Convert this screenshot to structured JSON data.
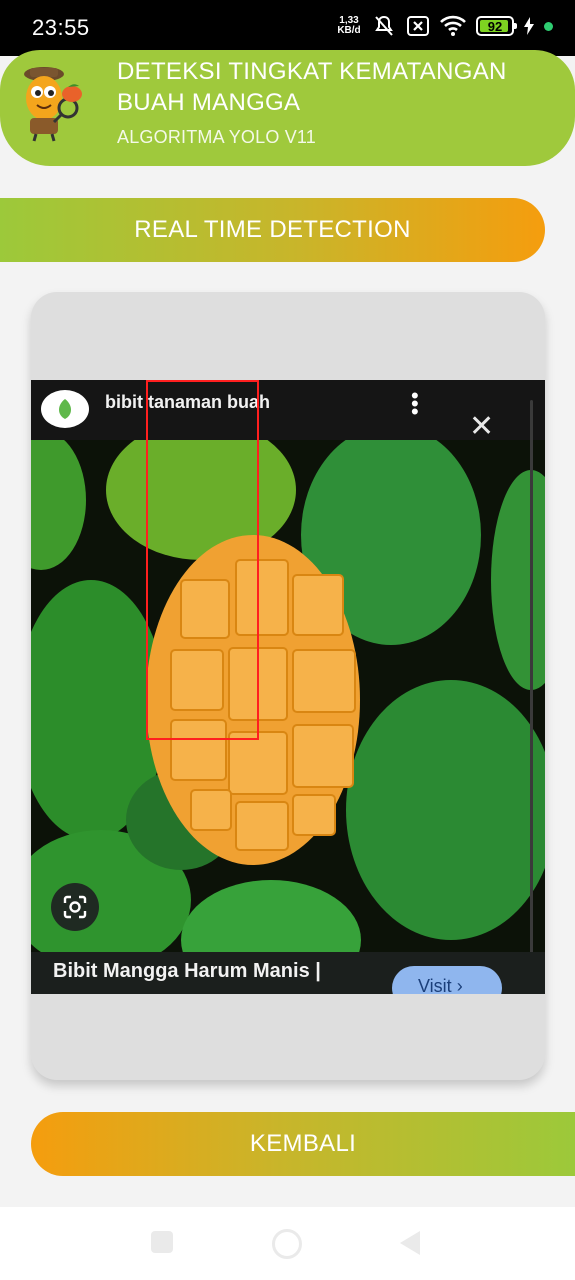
{
  "status_bar": {
    "time": "23:55",
    "net_speed_value": "1,33",
    "net_speed_unit": "KB/d",
    "battery": "92",
    "battery_level": 0.92,
    "icons": [
      "mute-vibrate-icon",
      "no-sim-icon",
      "wifi-icon",
      "battery-icon",
      "charging-icon",
      "notification-dot-icon"
    ]
  },
  "header": {
    "title": "DETEKSI TINGKAT KEMATANGAN BUAH MANGGA",
    "subtitle": "ALGORITMA YOLO V11",
    "logo_icon": "mango-detective-mascot-icon"
  },
  "realtime_button": {
    "label": "REAL TIME DETECTION"
  },
  "camera_feed": {
    "overlay_top_title": "bibit tanaman buah",
    "overlay_caption": "Bibit Mangga Harum Manis |",
    "visit_label": "Visit",
    "close_symbol": "✕",
    "lens_icon": "google-lens-icon",
    "detection_box_color": "#ff1f1f"
  },
  "back_button": {
    "label": "KEMBALI"
  },
  "colors": {
    "header_green": "#9fc93c",
    "gradient_green": "#9cc93a",
    "gradient_orange": "#f59d0e",
    "background": "#f3f3f3"
  }
}
